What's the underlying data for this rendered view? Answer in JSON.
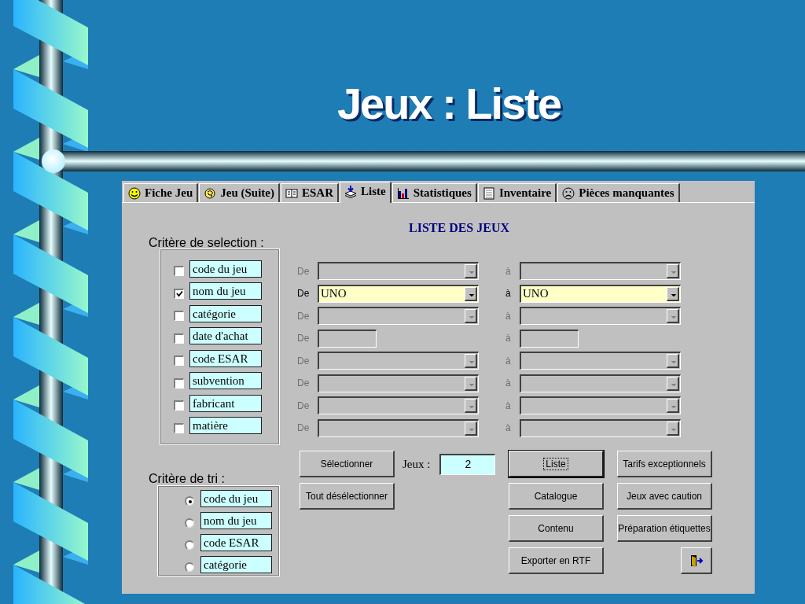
{
  "slide": {
    "title": "Jeux : Liste"
  },
  "tabs": [
    {
      "label": "Fiche Jeu",
      "selected": false
    },
    {
      "label": "Jeu (Suite)",
      "selected": false
    },
    {
      "label": "ESAR",
      "selected": false
    },
    {
      "label": "Liste",
      "selected": true
    },
    {
      "label": "Statistiques",
      "selected": false
    },
    {
      "label": "Inventaire",
      "selected": false
    },
    {
      "label": "Pièces manquantes",
      "selected": false
    }
  ],
  "form": {
    "heading": "LISTE DES JEUX",
    "selection_title": "Critère de selection :",
    "criteria": [
      {
        "label": "code du jeu",
        "checked": false,
        "kind": "combo",
        "from": {
          "label": "De"
        },
        "to": {
          "label": "à"
        }
      },
      {
        "label": "nom du jeu",
        "checked": true,
        "kind": "combo",
        "from": {
          "label": "De",
          "value": "UNO"
        },
        "to": {
          "label": "à",
          "value": "UNO"
        }
      },
      {
        "label": "catégorie",
        "checked": false,
        "kind": "combo",
        "from": {
          "label": "De"
        },
        "to": {
          "label": "à"
        }
      },
      {
        "label": "date d'achat",
        "checked": false,
        "kind": "text",
        "from": {
          "label": "De"
        },
        "to": {
          "label": "à"
        }
      },
      {
        "label": "code ESAR",
        "checked": false,
        "kind": "combo",
        "from": {
          "label": "De"
        },
        "to": {
          "label": "à"
        }
      },
      {
        "label": "subvention",
        "checked": false,
        "kind": "combo",
        "from": {
          "label": "De"
        },
        "to": {
          "label": "à"
        }
      },
      {
        "label": "fabricant",
        "checked": false,
        "kind": "combo",
        "from": {
          "label": "De"
        },
        "to": {
          "label": "à"
        }
      },
      {
        "label": "matière",
        "checked": false,
        "kind": "combo",
        "from": {
          "label": "De"
        },
        "to": {
          "label": "à"
        }
      }
    ],
    "sort_title": "Critère de tri :",
    "sort_options": [
      {
        "label": "code du jeu",
        "selected": true
      },
      {
        "label": "nom du jeu",
        "selected": false
      },
      {
        "label": "code ESAR",
        "selected": false
      },
      {
        "label": "catégorie",
        "selected": false
      }
    ],
    "count": {
      "label": "Jeux :",
      "value": "2"
    },
    "button_columns": [
      [
        {
          "kind": "text",
          "label": "Sélectionner",
          "default": false
        },
        {
          "kind": "text",
          "label": "Tout désélectionner",
          "default": false
        }
      ],
      [
        {
          "kind": "text",
          "label": "Liste",
          "default": true
        },
        {
          "kind": "text",
          "label": "Catalogue",
          "default": false
        },
        {
          "kind": "text",
          "label": "Contenu",
          "default": false
        },
        {
          "kind": "text",
          "label": "Exporter en RTF",
          "default": false
        }
      ],
      [
        {
          "kind": "text",
          "label": "Tarifs exceptionnels",
          "default": false
        },
        {
          "kind": "text",
          "label": "Jeux avec caution",
          "default": false
        },
        {
          "kind": "text",
          "label": "Préparation étiquettes",
          "default": false
        },
        {
          "kind": "icon",
          "default": false
        }
      ]
    ]
  }
}
